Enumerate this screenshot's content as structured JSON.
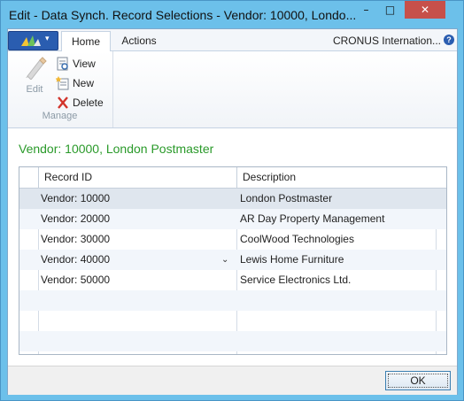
{
  "window": {
    "title": "Edit - Data Synch. Record Selections - Vendor: 10000, Londo...",
    "minimize_glyph": "–",
    "maximize_glyph": "□",
    "close_glyph": "✕"
  },
  "ribbon": {
    "tabs": [
      "Home",
      "Actions"
    ],
    "company": "CRONUS Internation...",
    "help_glyph": "?",
    "app_menu_arrow": "▾",
    "group": {
      "label": "Manage",
      "edit_label": "Edit",
      "view_label": "View",
      "new_label": "New",
      "delete_label": "Delete"
    }
  },
  "page": {
    "heading": "Vendor: 10000, London Postmaster"
  },
  "grid": {
    "columns": [
      "Record ID",
      "Description"
    ],
    "rows": [
      {
        "record_id": "Vendor: 10000",
        "description": "London Postmaster"
      },
      {
        "record_id": "Vendor: 20000",
        "description": "AR Day Property Management"
      },
      {
        "record_id": "Vendor: 30000",
        "description": "CoolWood Technologies"
      },
      {
        "record_id": "Vendor: 40000",
        "description": "Lewis Home Furniture"
      },
      {
        "record_id": "Vendor: 50000",
        "description": "Service Electronics Ltd."
      }
    ],
    "dropdown_glyph": "⌄"
  },
  "footer": {
    "ok_label": "OK"
  }
}
